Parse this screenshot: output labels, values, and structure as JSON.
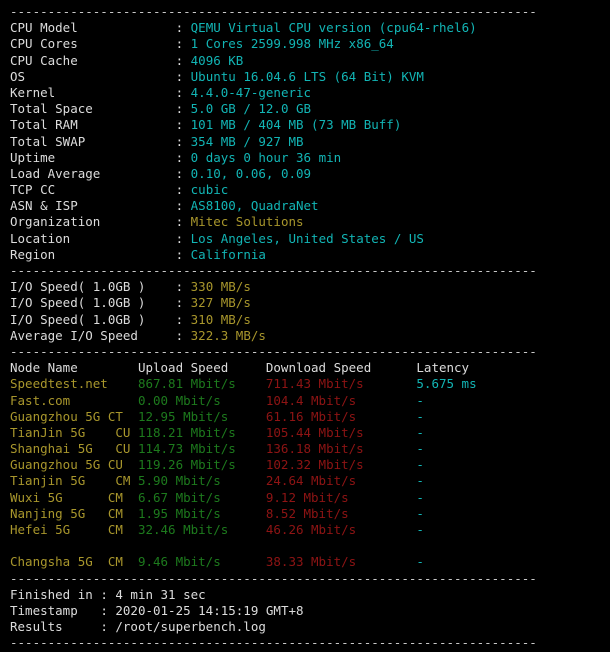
{
  "terminal": {
    "separator": "----------------------------------------------------------------------",
    "sysinfo": {
      "rows": [
        {
          "label": "CPU Model",
          "sep": ":",
          "value": "QEMU Virtual CPU version (cpu64-rhel6)",
          "color": "cyan"
        },
        {
          "label": "CPU Cores",
          "sep": ":",
          "value": "1 Cores 2599.998 MHz x86_64",
          "color": "cyan"
        },
        {
          "label": "CPU Cache",
          "sep": ":",
          "value": "4096 KB",
          "color": "cyan"
        },
        {
          "label": "OS",
          "sep": ":",
          "value": "Ubuntu 16.04.6 LTS (64 Bit) KVM",
          "color": "cyan"
        },
        {
          "label": "Kernel",
          "sep": ":",
          "value": "4.4.0-47-generic",
          "color": "cyan"
        },
        {
          "label": "Total Space",
          "sep": ":",
          "value": "5.0 GB / 12.0 GB",
          "color": "cyan"
        },
        {
          "label": "Total RAM",
          "sep": ":",
          "value": "101 MB / 404 MB (73 MB Buff)",
          "color": "cyan"
        },
        {
          "label": "Total SWAP",
          "sep": ":",
          "value": "354 MB / 927 MB",
          "color": "cyan"
        },
        {
          "label": "Uptime",
          "sep": ":",
          "value": "0 days 0 hour 36 min",
          "color": "cyan"
        },
        {
          "label": "Load Average",
          "sep": ":",
          "value": "0.10, 0.06, 0.09",
          "color": "cyan"
        },
        {
          "label": "TCP CC",
          "sep": ":",
          "value": "cubic",
          "color": "cyan"
        },
        {
          "label": "ASN & ISP",
          "sep": ":",
          "value": "AS8100, QuadraNet",
          "color": "cyan"
        },
        {
          "label": "Organization",
          "sep": ":",
          "value": "Mitec Solutions",
          "color": "yellow"
        },
        {
          "label": "Location",
          "sep": ":",
          "value": "Los Angeles, United States / US",
          "color": "cyan"
        },
        {
          "label": "Region",
          "sep": ":",
          "value": "California",
          "color": "cyan"
        }
      ]
    },
    "iospeed": {
      "rows": [
        {
          "label": "I/O Speed( 1.0GB )",
          "sep": ":",
          "value": "330 MB/s",
          "color": "yellow"
        },
        {
          "label": "I/O Speed( 1.0GB )",
          "sep": ":",
          "value": "327 MB/s",
          "color": "yellow"
        },
        {
          "label": "I/O Speed( 1.0GB )",
          "sep": ":",
          "value": "310 MB/s",
          "color": "yellow"
        },
        {
          "label": "Average I/O Speed",
          "sep": ":",
          "value": "322.3 MB/s",
          "color": "yellow"
        }
      ]
    },
    "speedtest": {
      "headers": [
        "Node Name",
        "Upload Speed",
        "Download Speed",
        "Latency"
      ],
      "rows": [
        {
          "node": "Speedtest.net",
          "upload": "867.81 Mbit/s",
          "download": "711.43 Mbit/s",
          "latency": "5.675 ms"
        },
        {
          "node": "Fast.com",
          "upload": "0.00 Mbit/s",
          "download": "104.4 Mbit/s",
          "latency": "-"
        },
        {
          "node": "Guangzhou 5G CT",
          "upload": "12.95 Mbit/s",
          "download": "61.16 Mbit/s",
          "latency": "-"
        },
        {
          "node": "TianJin 5G    CU",
          "upload": "118.21 Mbit/s",
          "download": "105.44 Mbit/s",
          "latency": "-"
        },
        {
          "node": "Shanghai 5G   CU",
          "upload": "114.73 Mbit/s",
          "download": "136.18 Mbit/s",
          "latency": "-"
        },
        {
          "node": "Guangzhou 5G CU",
          "upload": "119.26 Mbit/s",
          "download": "102.32 Mbit/s",
          "latency": "-"
        },
        {
          "node": "Tianjin 5G    CM",
          "upload": "5.90 Mbit/s",
          "download": "24.64 Mbit/s",
          "latency": "-"
        },
        {
          "node": "Wuxi 5G      CM",
          "upload": "6.67 Mbit/s",
          "download": "9.12 Mbit/s",
          "latency": "-"
        },
        {
          "node": "Nanjing 5G   CM",
          "upload": "1.95 Mbit/s",
          "download": "8.52 Mbit/s",
          "latency": "-"
        },
        {
          "node": "Hefei 5G     CM",
          "upload": "32.46 Mbit/s",
          "download": "46.26 Mbit/s",
          "latency": "-"
        },
        {
          "node": "",
          "upload": "",
          "download": "",
          "latency": ""
        },
        {
          "node": "Changsha 5G  CM",
          "upload": "9.46 Mbit/s",
          "download": "38.33 Mbit/s",
          "latency": "-"
        }
      ]
    },
    "footer": {
      "rows": [
        {
          "label": "Finished in",
          "sep": ":",
          "value": "4 min 31 sec"
        },
        {
          "label": "Timestamp",
          "sep": ":",
          "value": "2020-01-25 14:15:19 GMT+8"
        },
        {
          "label": "Results",
          "sep": ":",
          "value": "/root/superbench.log"
        }
      ]
    },
    "colors": {
      "background": "#000000",
      "label": "#dcdcdc",
      "cyan": "#12b5b5",
      "yellow": "#a8962c",
      "upload_green": "#1d7a1d",
      "download_red": "#8e1414",
      "latency_cyan": "#12b5b5"
    }
  }
}
